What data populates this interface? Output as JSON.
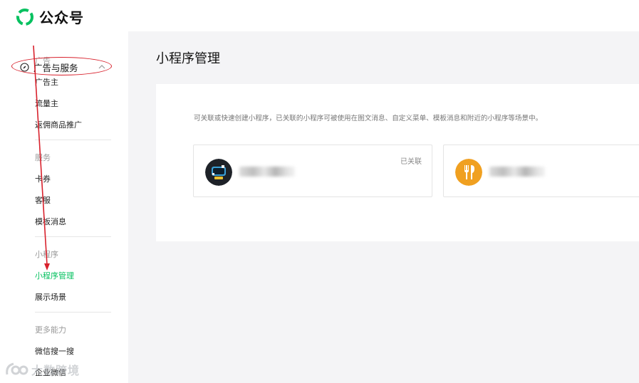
{
  "app": {
    "title": "公众号"
  },
  "nav": {
    "group_label": "广告与服务",
    "sections": [
      {
        "title": "广告",
        "items": [
          "广告主",
          "流量主",
          "返佣商品推广"
        ]
      },
      {
        "title": "服务",
        "items": [
          "卡券",
          "客服",
          "模板消息"
        ]
      },
      {
        "title": "小程序",
        "items": [
          "小程序管理",
          "展示场景"
        ]
      },
      {
        "title": "更多能力",
        "items": [
          "微信搜一搜",
          "企业微信"
        ]
      }
    ],
    "active_item": "小程序管理"
  },
  "main": {
    "title": "小程序管理",
    "description": "可关联或快速创建小程序，已关联的小程序可被使用在图文消息、自定义菜单、模板消息和附近的小程序等场景中。",
    "cards": [
      {
        "status": "已关联",
        "avatar_icon": "game-controller-icon"
      },
      {
        "status": "",
        "avatar_icon": "fork-knife-icon"
      }
    ]
  },
  "watermark": {
    "text": "大数跨境"
  },
  "colors": {
    "accent": "#07c160",
    "annotation": "#d8212c",
    "food_avatar": "#f0a020"
  }
}
